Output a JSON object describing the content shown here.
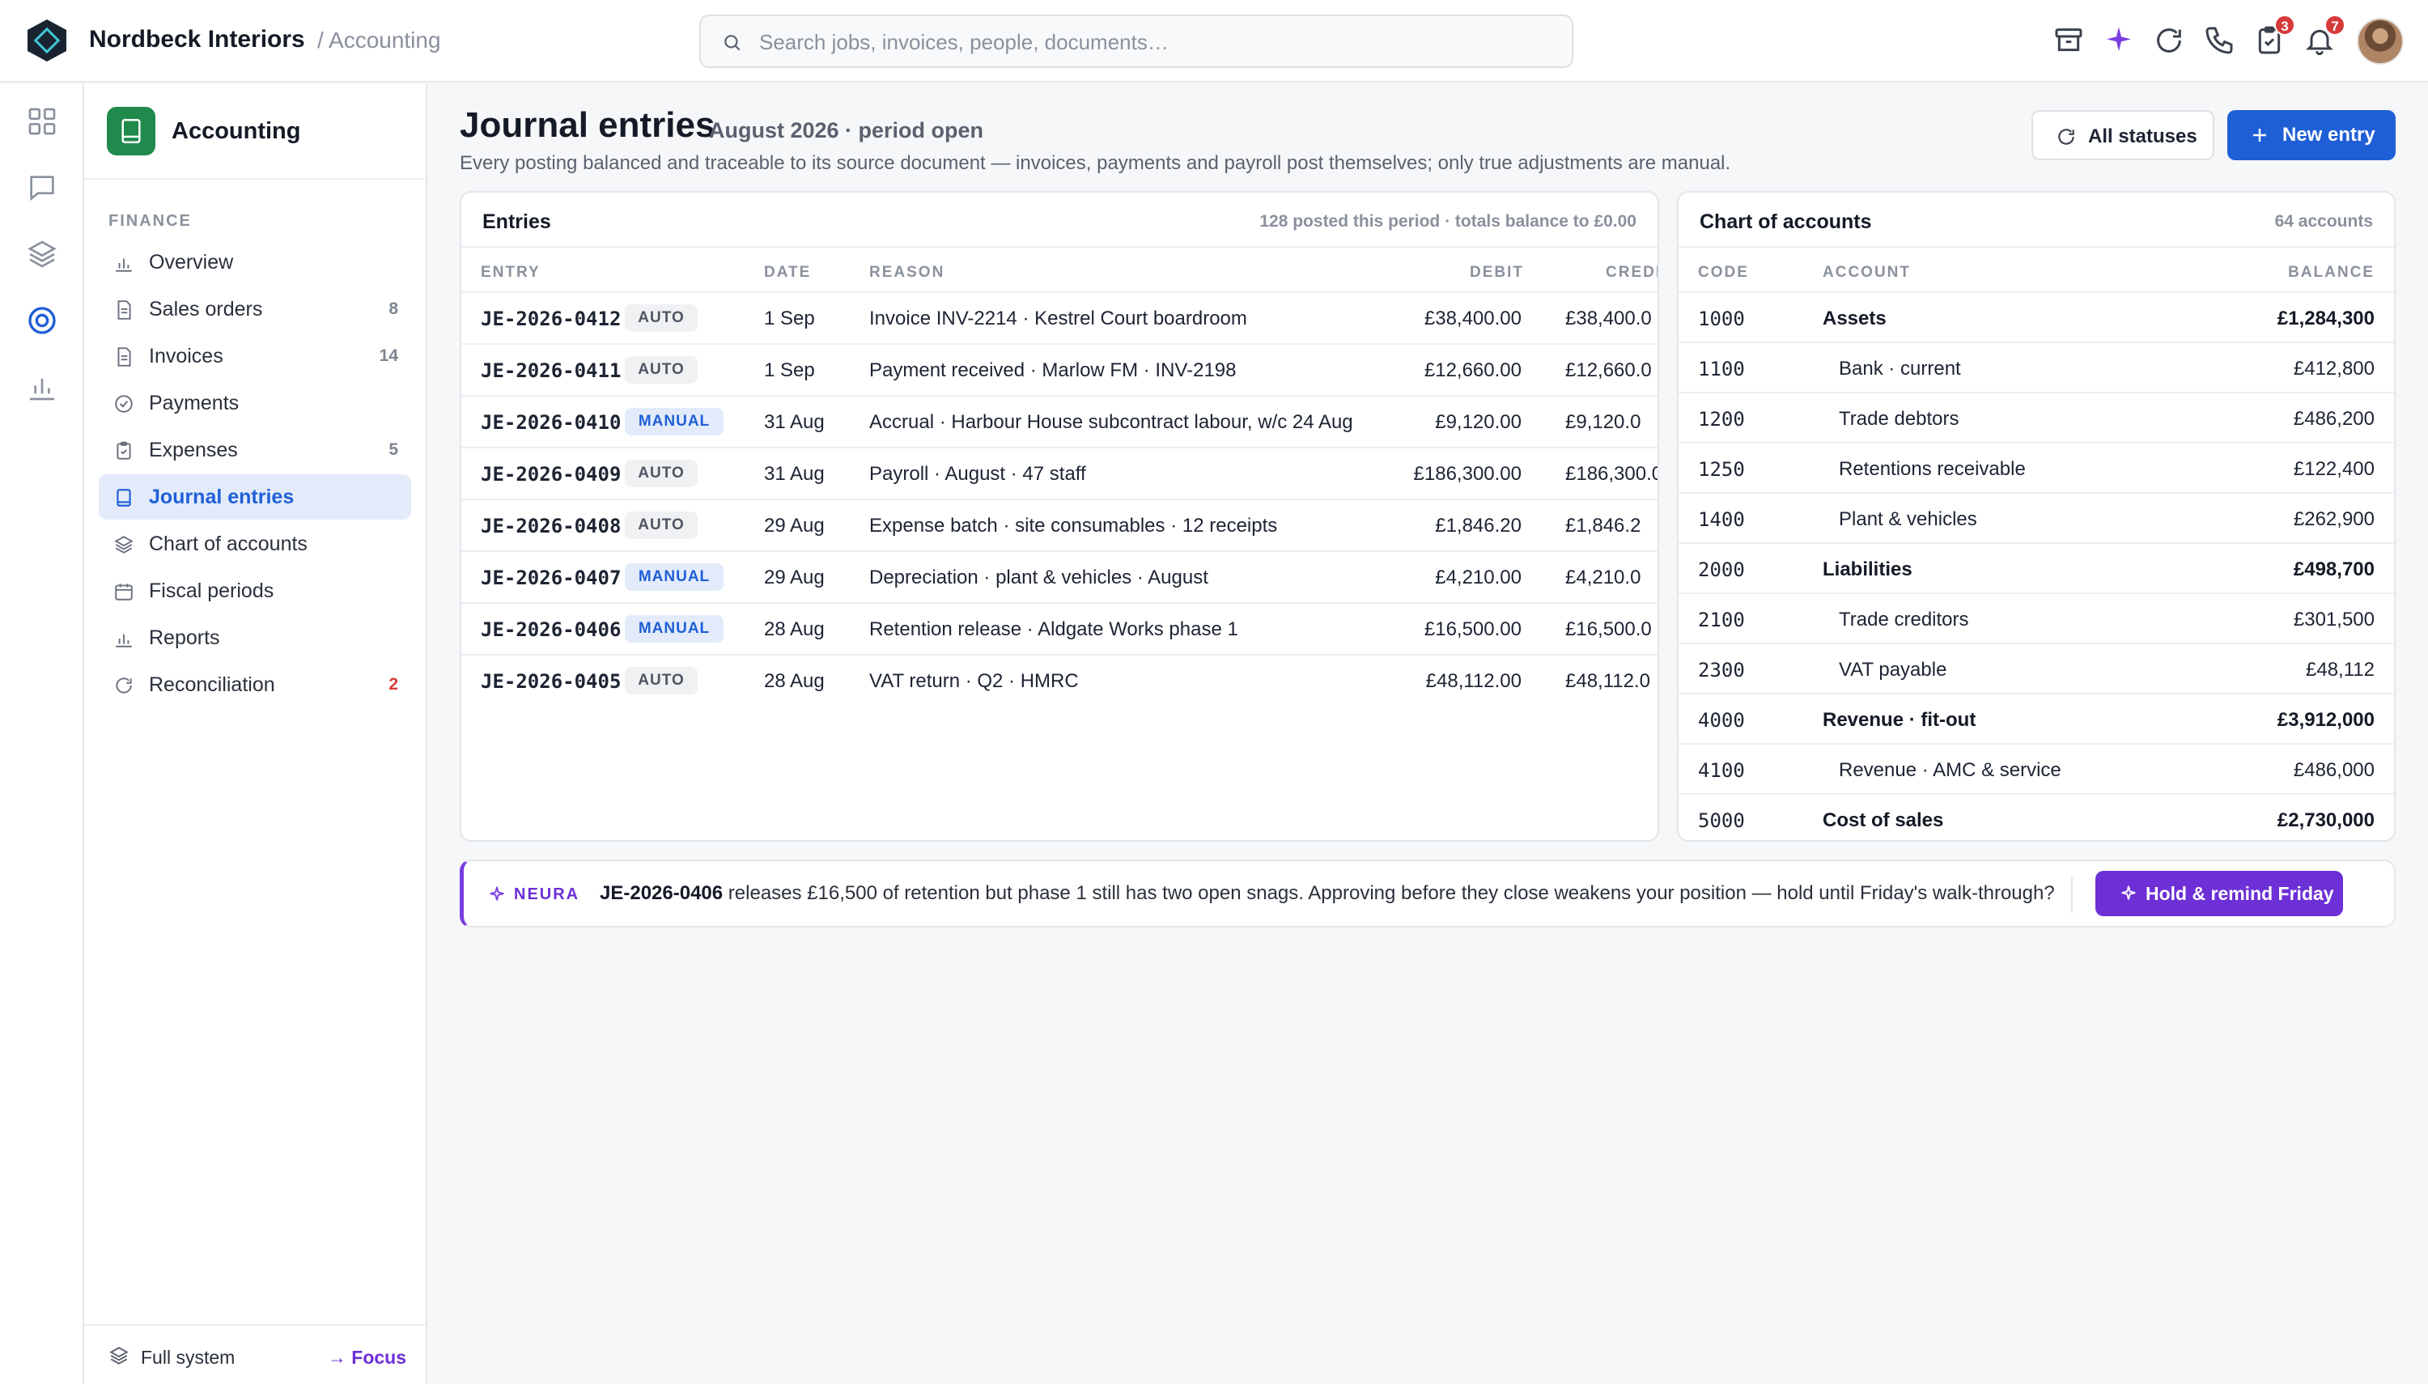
{
  "header": {
    "brand": "Nordbeck Interiors",
    "breadcrumb": "/ Accounting",
    "search_placeholder": "Search jobs, invoices, people, documents…",
    "tasks_badge": "3",
    "notifications_badge": "7"
  },
  "sidebar": {
    "app_title": "Accounting",
    "section_label": "FINANCE",
    "items": [
      {
        "label": "Overview",
        "count": ""
      },
      {
        "label": "Sales orders",
        "count": "8"
      },
      {
        "label": "Invoices",
        "count": "14"
      },
      {
        "label": "Payments",
        "count": ""
      },
      {
        "label": "Expenses",
        "count": "5"
      },
      {
        "label": "Journal entries",
        "count": ""
      },
      {
        "label": "Chart of accounts",
        "count": ""
      },
      {
        "label": "Fiscal periods",
        "count": ""
      },
      {
        "label": "Reports",
        "count": ""
      },
      {
        "label": "Reconciliation",
        "count": "2"
      }
    ],
    "footer_left": "Full system",
    "footer_right": "→ Focus"
  },
  "page": {
    "title": "Journal entries",
    "period": "August 2026 · period open",
    "subtitle": "Every posting balanced and traceable to its source document — invoices, payments and payroll post themselves; only true adjustments are manual.",
    "status_button": "All statuses",
    "new_button": "New entry"
  },
  "entries": {
    "title": "Entries",
    "meta": "128 posted this period · totals balance to £0.00",
    "columns": {
      "entry": "ENTRY",
      "date": "DATE",
      "reason": "REASON",
      "debit": "DEBIT",
      "credit": "CREDI"
    },
    "rows": [
      {
        "id": "JE-2026-0412",
        "tag": "AUTO",
        "date": "1 Sep",
        "reason": "Invoice INV-2214 · Kestrel Court boardroom",
        "debit": "£38,400.00",
        "credit": "£38,400.0"
      },
      {
        "id": "JE-2026-0411",
        "tag": "AUTO",
        "date": "1 Sep",
        "reason": "Payment received · Marlow FM · INV-2198",
        "debit": "£12,660.00",
        "credit": "£12,660.0"
      },
      {
        "id": "JE-2026-0410",
        "tag": "MANUAL",
        "date": "31 Aug",
        "reason": "Accrual · Harbour House subcontract labour, w/c 24 Aug",
        "debit": "£9,120.00",
        "credit": "£9,120.0"
      },
      {
        "id": "JE-2026-0409",
        "tag": "AUTO",
        "date": "31 Aug",
        "reason": "Payroll · August · 47 staff",
        "debit": "£186,300.00",
        "credit": "£186,300.0"
      },
      {
        "id": "JE-2026-0408",
        "tag": "AUTO",
        "date": "29 Aug",
        "reason": "Expense batch · site consumables · 12 receipts",
        "debit": "£1,846.20",
        "credit": "£1,846.2"
      },
      {
        "id": "JE-2026-0407",
        "tag": "MANUAL",
        "date": "29 Aug",
        "reason": "Depreciation · plant & vehicles · August",
        "debit": "£4,210.00",
        "credit": "£4,210.0"
      },
      {
        "id": "JE-2026-0406",
        "tag": "MANUAL",
        "date": "28 Aug",
        "reason": "Retention release · Aldgate Works phase 1",
        "debit": "£16,500.00",
        "credit": "£16,500.0"
      },
      {
        "id": "JE-2026-0405",
        "tag": "AUTO",
        "date": "28 Aug",
        "reason": "VAT return · Q2 · HMRC",
        "debit": "£48,112.00",
        "credit": "£48,112.0"
      }
    ]
  },
  "accounts": {
    "title": "Chart of accounts",
    "meta": "64 accounts",
    "columns": {
      "code": "CODE",
      "account": "ACCOUNT",
      "balance": "BALANCE"
    },
    "rows": [
      {
        "code": "1000",
        "name": "Assets",
        "balance": "£1,284,300",
        "bold": true
      },
      {
        "code": "1100",
        "name": "Bank · current",
        "balance": "£412,800",
        "bold": false
      },
      {
        "code": "1200",
        "name": "Trade debtors",
        "balance": "£486,200",
        "bold": false
      },
      {
        "code": "1250",
        "name": "Retentions receivable",
        "balance": "£122,400",
        "bold": false
      },
      {
        "code": "1400",
        "name": "Plant & vehicles",
        "balance": "£262,900",
        "bold": false
      },
      {
        "code": "2000",
        "name": "Liabilities",
        "balance": "£498,700",
        "bold": true
      },
      {
        "code": "2100",
        "name": "Trade creditors",
        "balance": "£301,500",
        "bold": false
      },
      {
        "code": "2300",
        "name": "VAT payable",
        "balance": "£48,112",
        "bold": false
      },
      {
        "code": "4000",
        "name": "Revenue · fit-out",
        "balance": "£3,912,000",
        "bold": true
      },
      {
        "code": "4100",
        "name": "Revenue · AMC & service",
        "balance": "£486,000",
        "bold": false
      },
      {
        "code": "5000",
        "name": "Cost of sales",
        "balance": "£2,730,000",
        "bold": true
      }
    ]
  },
  "neura": {
    "label": "NEURA",
    "entry_ref": "JE-2026-0406",
    "message": " releases £16,500 of retention but phase 1 still has two open snags. Approving before they close weakens your position — hold until Friday's walk-through?",
    "action": "Hold & remind Friday"
  },
  "colors": {
    "accent": "#1f5fd6",
    "neura": "#6d2fd6",
    "app_icon": "#1f8a4c",
    "badge": "#d63a3a"
  }
}
